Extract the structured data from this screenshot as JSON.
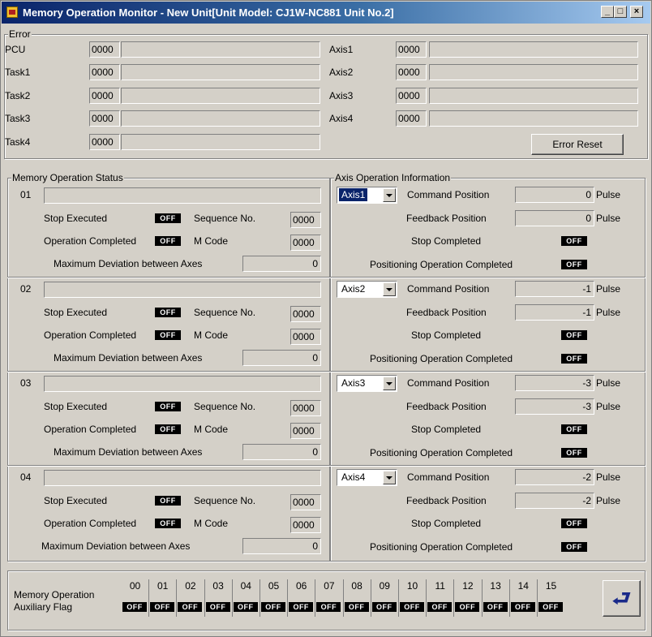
{
  "window": {
    "title": "Memory Operation Monitor - New Unit[Unit Model: CJ1W-NC881 Unit No.2]",
    "minimize_glyph": "_",
    "maximize_glyph": "□",
    "close_glyph": "×"
  },
  "error": {
    "legend": "Error",
    "left": [
      {
        "label": "PCU",
        "code": "0000"
      },
      {
        "label": "Task1",
        "code": "0000"
      },
      {
        "label": "Task2",
        "code": "0000"
      },
      {
        "label": "Task3",
        "code": "0000"
      },
      {
        "label": "Task4",
        "code": "0000"
      }
    ],
    "right": [
      {
        "label": "Axis1",
        "code": "0000"
      },
      {
        "label": "Axis2",
        "code": "0000"
      },
      {
        "label": "Axis3",
        "code": "0000"
      },
      {
        "label": "Axis4",
        "code": "0000"
      }
    ],
    "reset_label": "Error Reset"
  },
  "memory_status": {
    "legend": "Memory Operation Status",
    "labels": {
      "stop_executed": "Stop Executed",
      "operation_completed": "Operation Completed",
      "sequence_no": "Sequence No.",
      "m_code": "M Code",
      "max_deviation": "Maximum Deviation between Axes"
    },
    "groups": [
      {
        "id": "01",
        "stop": "OFF",
        "completed": "OFF",
        "sequence": "0000",
        "mcode": "0000",
        "deviation": "0"
      },
      {
        "id": "02",
        "stop": "OFF",
        "completed": "OFF",
        "sequence": "0000",
        "mcode": "0000",
        "deviation": "0"
      },
      {
        "id": "03",
        "stop": "OFF",
        "completed": "OFF",
        "sequence": "0000",
        "mcode": "0000",
        "deviation": "0"
      },
      {
        "id": "04",
        "stop": "OFF",
        "completed": "OFF",
        "sequence": "0000",
        "mcode": "0000",
        "deviation": "0"
      }
    ]
  },
  "axis_info": {
    "legend": "Axis Operation Information",
    "labels": {
      "command_position": "Command Position",
      "feedback_position": "Feedback Position",
      "stop_completed": "Stop Completed",
      "positioning_completed": "Positioning Operation Completed",
      "unit": "Pulse"
    },
    "axes": [
      {
        "selected": "Axis1",
        "command": "0",
        "feedback": "0",
        "stop": "OFF",
        "positioning": "OFF"
      },
      {
        "selected": "Axis2",
        "command": "-1",
        "feedback": "-1",
        "stop": "OFF",
        "positioning": "OFF"
      },
      {
        "selected": "Axis3",
        "command": "-3",
        "feedback": "-3",
        "stop": "OFF",
        "positioning": "OFF"
      },
      {
        "selected": "Axis4",
        "command": "-2",
        "feedback": "-2",
        "stop": "OFF",
        "positioning": "OFF"
      }
    ]
  },
  "aux_flag": {
    "label_line1": "Memory Operation",
    "label_line2": "Auxiliary Flag",
    "headers": [
      "00",
      "01",
      "02",
      "03",
      "04",
      "05",
      "06",
      "07",
      "08",
      "09",
      "10",
      "11",
      "12",
      "13",
      "14",
      "15"
    ],
    "values": [
      "OFF",
      "OFF",
      "OFF",
      "OFF",
      "OFF",
      "OFF",
      "OFF",
      "OFF",
      "OFF",
      "OFF",
      "OFF",
      "OFF",
      "OFF",
      "OFF",
      "OFF",
      "OFF"
    ]
  },
  "return_glyph": "⮐"
}
